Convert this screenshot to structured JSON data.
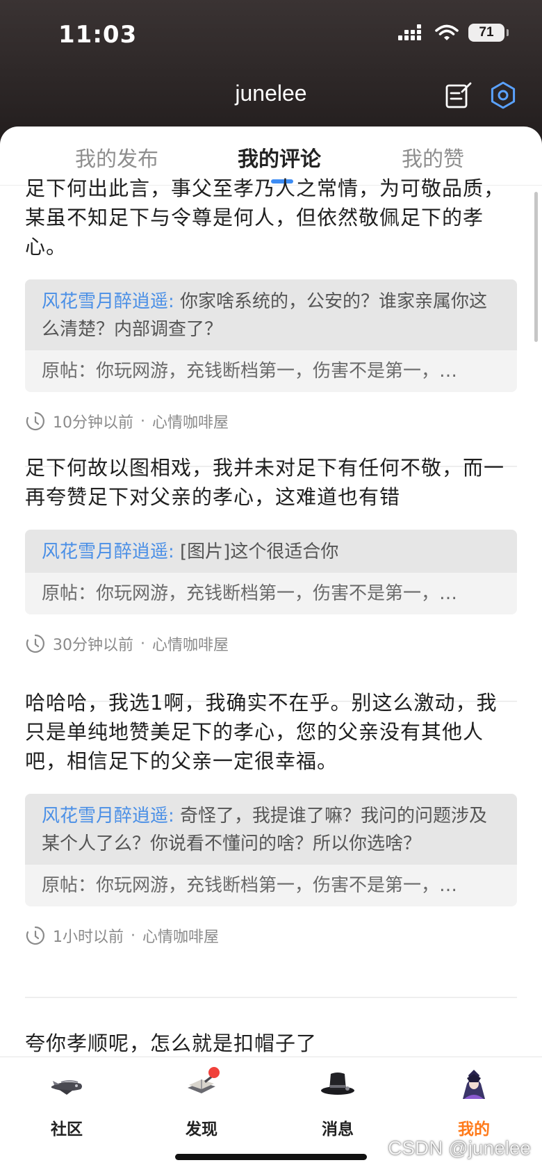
{
  "status_bar": {
    "time": "11:03",
    "battery": "71",
    "signal_icon": "cellular-signal-icon",
    "wifi_icon": "wifi-icon"
  },
  "header": {
    "title": "junelee",
    "edit_icon": "edit-note-icon",
    "settings_icon": "gear-icon"
  },
  "tabs": [
    {
      "label": "我的发布",
      "active": false
    },
    {
      "label": "我的评论",
      "active": true
    },
    {
      "label": "我的赞",
      "active": false
    }
  ],
  "comments": [
    {
      "text": "足下何出此言，事父至孝乃人之常情，为可敬品质，某虽不知足下与令尊是何人，但依然敬佩足下的孝心。",
      "reply_user": "风花雪月醉逍遥:",
      "reply_text": "你家啥系统的，公安的？谁家亲属你这么清楚？内部调查了？",
      "origin": "原帖：你玩网游，充钱断档第一，伤害不是第一，…",
      "time": "10分钟以前",
      "separator": "·",
      "board": "心情咖啡屋"
    },
    {
      "text": "足下何故以图相戏，我并未对足下有任何不敬，而一再夸赞足下对父亲的孝心，这难道也有错",
      "reply_user": "风花雪月醉逍遥:",
      "reply_text": "[图片]这个很适合你",
      "origin": "原帖：你玩网游，充钱断档第一，伤害不是第一，…",
      "time": "30分钟以前",
      "separator": "·",
      "board": "心情咖啡屋"
    },
    {
      "text": "哈哈哈，我选1啊，我确实不在乎。别这么激动，我只是单纯地赞美足下的孝心，您的父亲没有其他人吧，相信足下的父亲一定很幸福。",
      "reply_user": "风花雪月醉逍遥:",
      "reply_text": "奇怪了，我提谁了嘛？我问的问题涉及某个人了么？你说看不懂问的啥？所以你选啥？",
      "origin": "原帖：你玩网游，充钱断档第一，伤害不是第一，…",
      "time": "1小时以前",
      "separator": "·",
      "board": "心情咖啡屋"
    },
    {
      "text": "夸你孝顺呢，怎么就是扣帽子了"
    }
  ],
  "bottom_nav": [
    {
      "label": "社区",
      "icon": "airship-icon",
      "active": false
    },
    {
      "label": "发现",
      "icon": "book-icon",
      "active": false,
      "badge": true
    },
    {
      "label": "消息",
      "icon": "top-hat-icon",
      "active": false
    },
    {
      "label": "我的",
      "icon": "avatar-icon",
      "active": true
    }
  ],
  "watermark": "CSDN @junelee",
  "colors": {
    "accent_blue": "#3d8cf3",
    "reply_user_blue": "#4a8fe6",
    "active_orange": "#ff7a1a",
    "badge_red": "#f0413b"
  }
}
